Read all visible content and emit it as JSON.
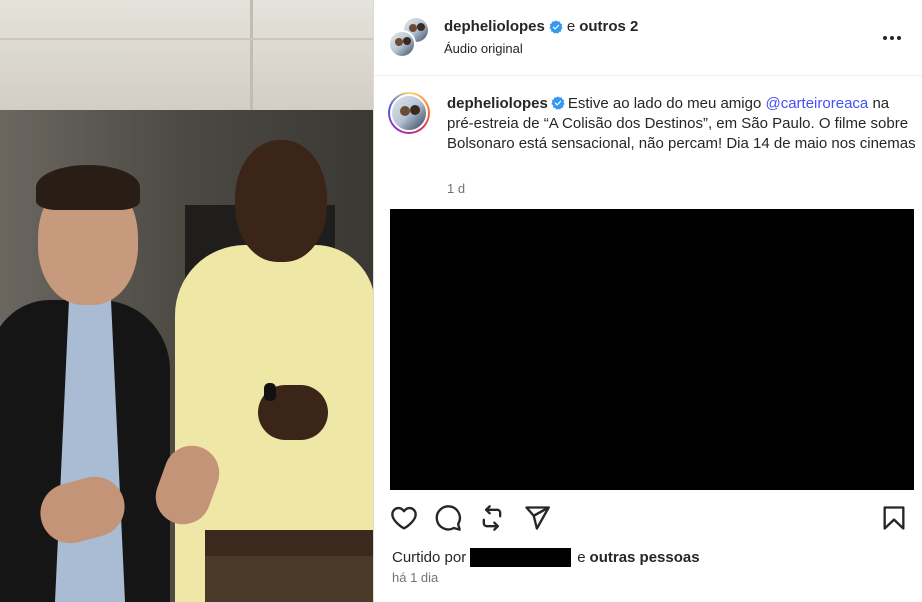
{
  "post": {
    "header": {
      "username": "depheliolopes",
      "and_text": "e",
      "others_text": "outros 2",
      "audio_text": "Áudio original"
    },
    "caption": {
      "username": "depheliolopes",
      "text_before_mention": "Estive ao lado do meu amigo",
      "mention": "@carteiroreaca",
      "text_after_mention": "na pré-estreia de “A Colisão dos Destinos”, em São Paulo. O filme sobre Bolsonaro está sensacional, não percam! Dia 14 de maio nos cinemas",
      "time": "1 d"
    },
    "likes": {
      "prefix": "Curtido por",
      "and_text": "e",
      "others": "outras pessoas"
    },
    "timestamp": "há 1 dia"
  },
  "icons": {
    "verified": "verified-badge-icon",
    "more": "more-options-icon",
    "like": "heart-icon",
    "comment": "comment-icon",
    "share": "repost-icon",
    "send": "send-icon",
    "save": "bookmark-icon"
  },
  "colors": {
    "verified": "#3897f0",
    "mention": "#4150f7",
    "secondary_text": "#737373"
  }
}
